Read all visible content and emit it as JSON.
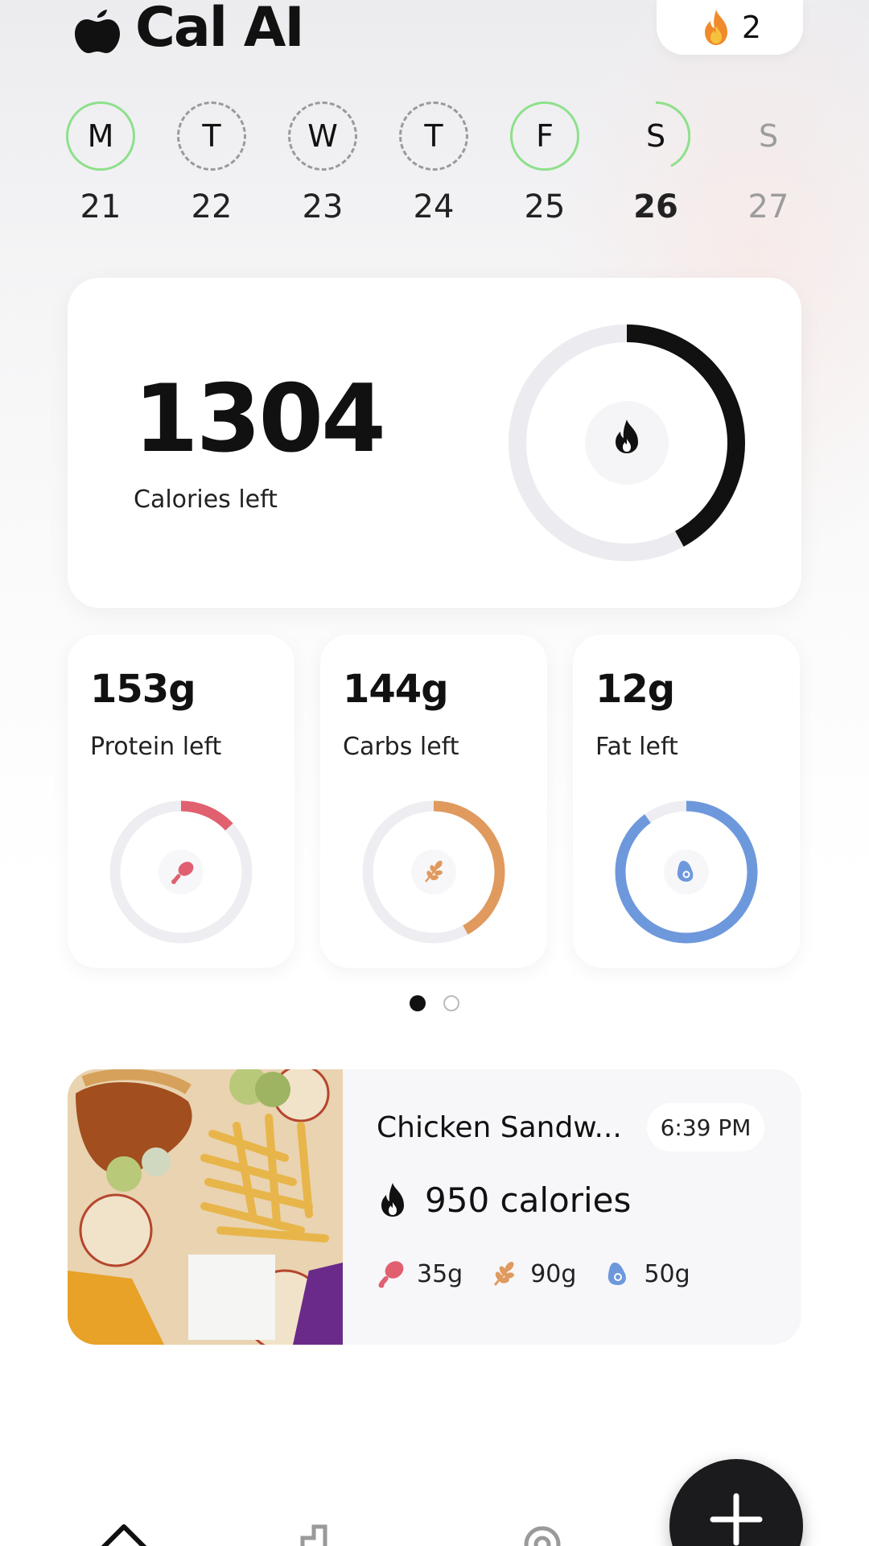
{
  "header": {
    "title": "Cal AI",
    "streak_count": "2",
    "logo_icon": "apple-icon",
    "streak_icon": "flame-icon"
  },
  "week": [
    {
      "letter": "M",
      "date": "21",
      "state": "done"
    },
    {
      "letter": "T",
      "date": "22",
      "state": "empty"
    },
    {
      "letter": "W",
      "date": "23",
      "state": "empty"
    },
    {
      "letter": "T",
      "date": "24",
      "state": "empty"
    },
    {
      "letter": "F",
      "date": "25",
      "state": "done"
    },
    {
      "letter": "S",
      "date": "26",
      "state": "today"
    },
    {
      "letter": "S",
      "date": "27",
      "state": "future"
    }
  ],
  "calories": {
    "value": "1304",
    "label": "Calories left",
    "progress": 0.42
  },
  "macros": [
    {
      "value": "153g",
      "label": "Protein left",
      "progress": 0.13,
      "color": "#e06070",
      "icon": "drumstick-icon"
    },
    {
      "value": "144g",
      "label": "Carbs left",
      "progress": 0.42,
      "color": "#e09a5e",
      "icon": "wheat-icon"
    },
    {
      "value": "12g",
      "label": "Fat left",
      "progress": 0.9,
      "color": "#6d98dc",
      "icon": "avocado-icon"
    }
  ],
  "pager": {
    "count": 2,
    "active": 0
  },
  "food_entry": {
    "name": "Chicken Sandw...",
    "time": "6:39 PM",
    "calories": "950 calories",
    "protein": "35g",
    "carbs": "90g",
    "fat": "50g"
  },
  "nav": {
    "items": [
      "home-icon",
      "progress-icon",
      "settings-icon"
    ],
    "fab": "plus-icon"
  },
  "colors": {
    "done_ring": "#8ee08a",
    "protein": "#e06070",
    "carbs": "#e09a5e",
    "fat": "#6d98dc"
  }
}
